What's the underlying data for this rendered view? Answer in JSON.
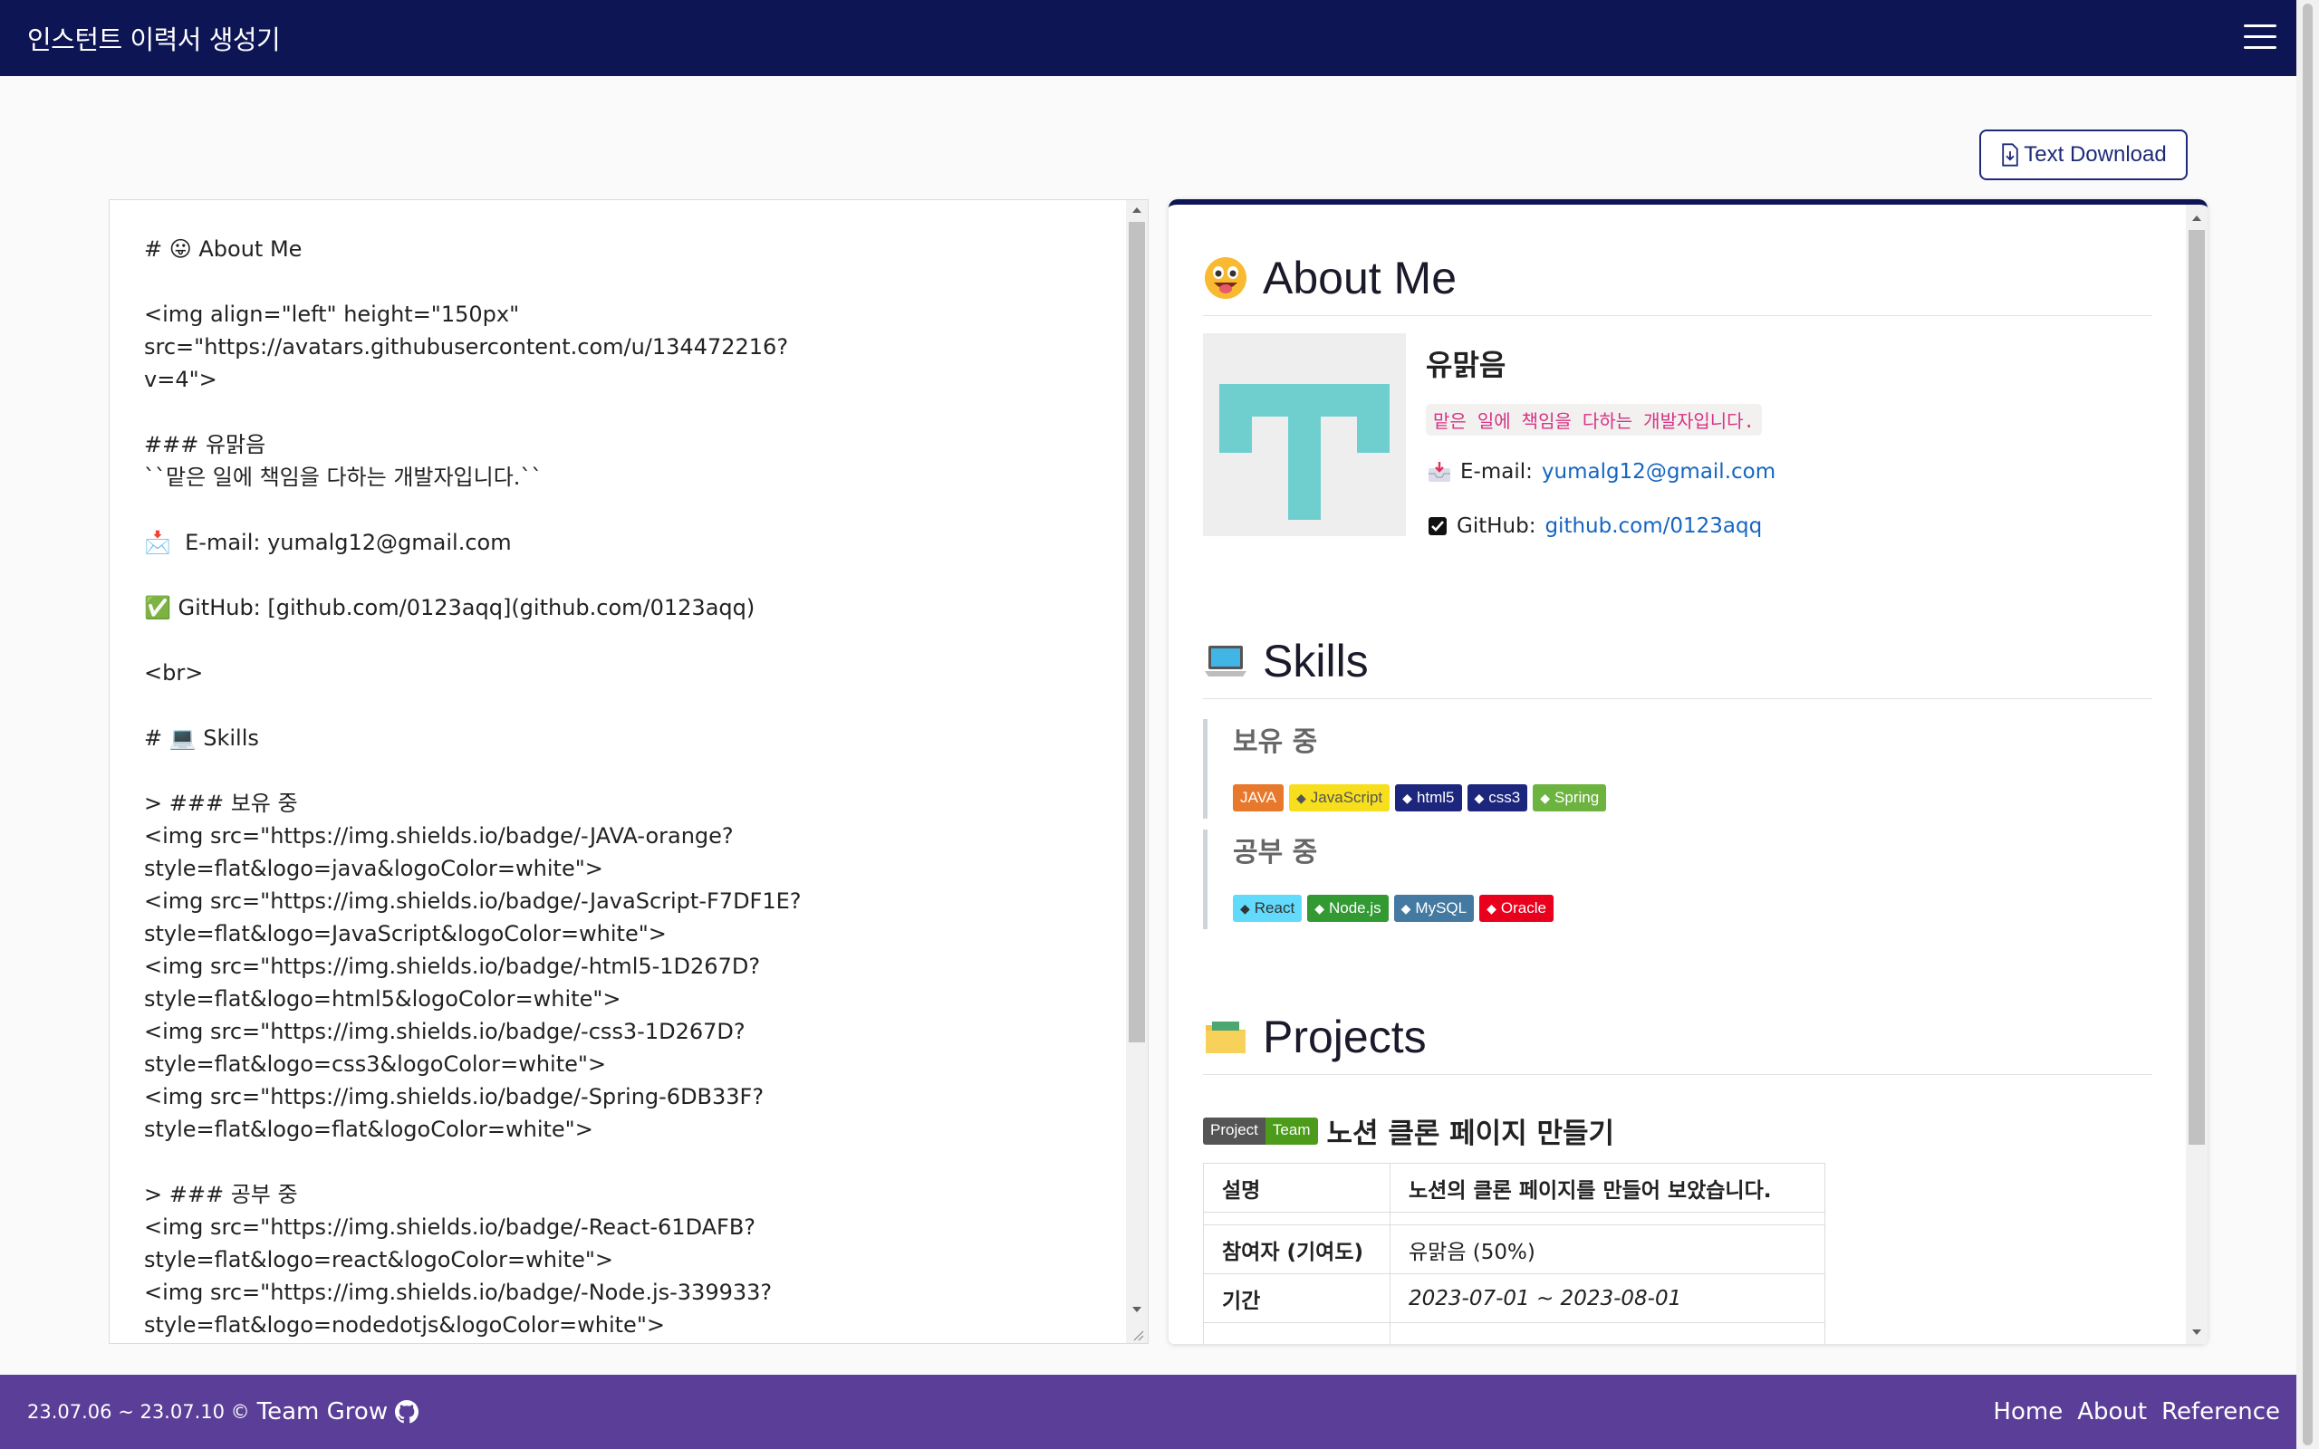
{
  "navbar": {
    "title": "인스턴트 이력서 생성기"
  },
  "toolbar": {
    "download_label": "Text Download"
  },
  "editor": {
    "content": "# 😛 About Me\n\n<img align=\"left\" height=\"150px\" src=\"https://avatars.githubusercontent.com/u/134472216?\nv=4\">\n\n### 유맑음\n``맡은 일에 책임을 다하는 개발자입니다.``\n\n📩  E-mail: yumalg12@gmail.com\n\n✅ GitHub: [github.com/0123aqq](github.com/0123aqq)\n\n<br>\n\n# 💻 Skills\n\n> ### 보유 중\n<img src=\"https://img.shields.io/badge/-JAVA-orange?\nstyle=flat&logo=java&logoColor=white\">\n<img src=\"https://img.shields.io/badge/-JavaScript-F7DF1E?\nstyle=flat&logo=JavaScript&logoColor=white\">\n<img src=\"https://img.shields.io/badge/-html5-1D267D?\nstyle=flat&logo=html5&logoColor=white\">\n<img src=\"https://img.shields.io/badge/-css3-1D267D?\nstyle=flat&logo=css3&logoColor=white\">\n<img src=\"https://img.shields.io/badge/-Spring-6DB33F?\nstyle=flat&logo=flat&logoColor=white\">\n\n> ### 공부 중\n<img src=\"https://img.shields.io/badge/-React-61DAFB?\nstyle=flat&logo=react&logoColor=white\">\n<img src=\"https://img.shields.io/badge/-Node.js-339933?\nstyle=flat&logo=nodedotjs&logoColor=white\">"
  },
  "preview": {
    "about": {
      "heading": "About Me",
      "name": "유맑음",
      "tagline": "맡은 일에 책임을 다하는 개발자입니다.",
      "email_label": "E-mail:",
      "email": "yumalg12@gmail.com",
      "github_label": "GitHub:",
      "github": "github.com/0123aqq"
    },
    "skills": {
      "heading": "Skills",
      "have_heading": "보유 중",
      "have": [
        {
          "label": "JAVA",
          "color": "#e8782b",
          "text": "#ffffff",
          "icon": ""
        },
        {
          "label": "JavaScript",
          "color": "#f7df1e",
          "text": "#555555",
          "icon": "js"
        },
        {
          "label": "html5",
          "color": "#1d267d",
          "text": "#ffffff",
          "icon": "html5-icon"
        },
        {
          "label": "css3",
          "color": "#1d267d",
          "text": "#ffffff",
          "icon": "css3-icon"
        },
        {
          "label": "Spring",
          "color": "#6db33f",
          "text": "#ffffff",
          "icon": "spring-icon"
        }
      ],
      "study_heading": "공부 중",
      "study": [
        {
          "label": "React",
          "color": "#61dafb",
          "text": "#333333",
          "icon": "react-icon"
        },
        {
          "label": "Node.js",
          "color": "#339933",
          "text": "#ffffff",
          "icon": "nodejs-icon"
        },
        {
          "label": "MySQL",
          "color": "#4479a1",
          "text": "#ffffff",
          "icon": "mysql-icon"
        },
        {
          "label": "Oracle",
          "color": "#e8001c",
          "text": "#ffffff",
          "icon": "oracle-icon"
        }
      ]
    },
    "projects": {
      "heading": "Projects",
      "badge_left": "Project",
      "badge_right": "Team",
      "title": "노션 클론 페이지 만들기",
      "rows": [
        {
          "key": "설명",
          "value": "노션의 클론 페이지를 만들어 보았습니다."
        },
        {
          "key": "참여자 (기여도)",
          "value": "유맑음 (50%)"
        },
        {
          "key": "기간",
          "value": "2023-07-01 ~ 2023-08-01"
        }
      ]
    }
  },
  "footer": {
    "period": "23.07.06 ~ 23.07.10 ©",
    "team": "Team Grow",
    "links": [
      "Home",
      "About",
      "Reference"
    ]
  }
}
